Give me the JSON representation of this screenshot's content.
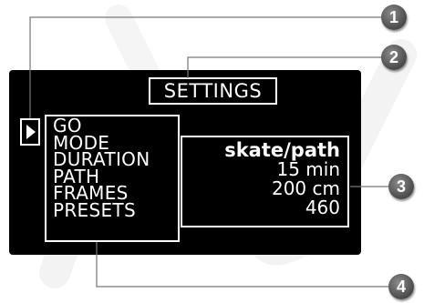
{
  "screen": {
    "title": "SETTINGS",
    "cursor_icon": "triangle-right-icon",
    "menu_items": [
      "GO",
      "MODE",
      "DURATION",
      "PATH",
      "FRAMES",
      "PRESETS"
    ],
    "values": [
      "skate/path",
      "15 min",
      "200 cm",
      "460"
    ]
  },
  "callouts": [
    "1",
    "2",
    "3",
    "4"
  ]
}
